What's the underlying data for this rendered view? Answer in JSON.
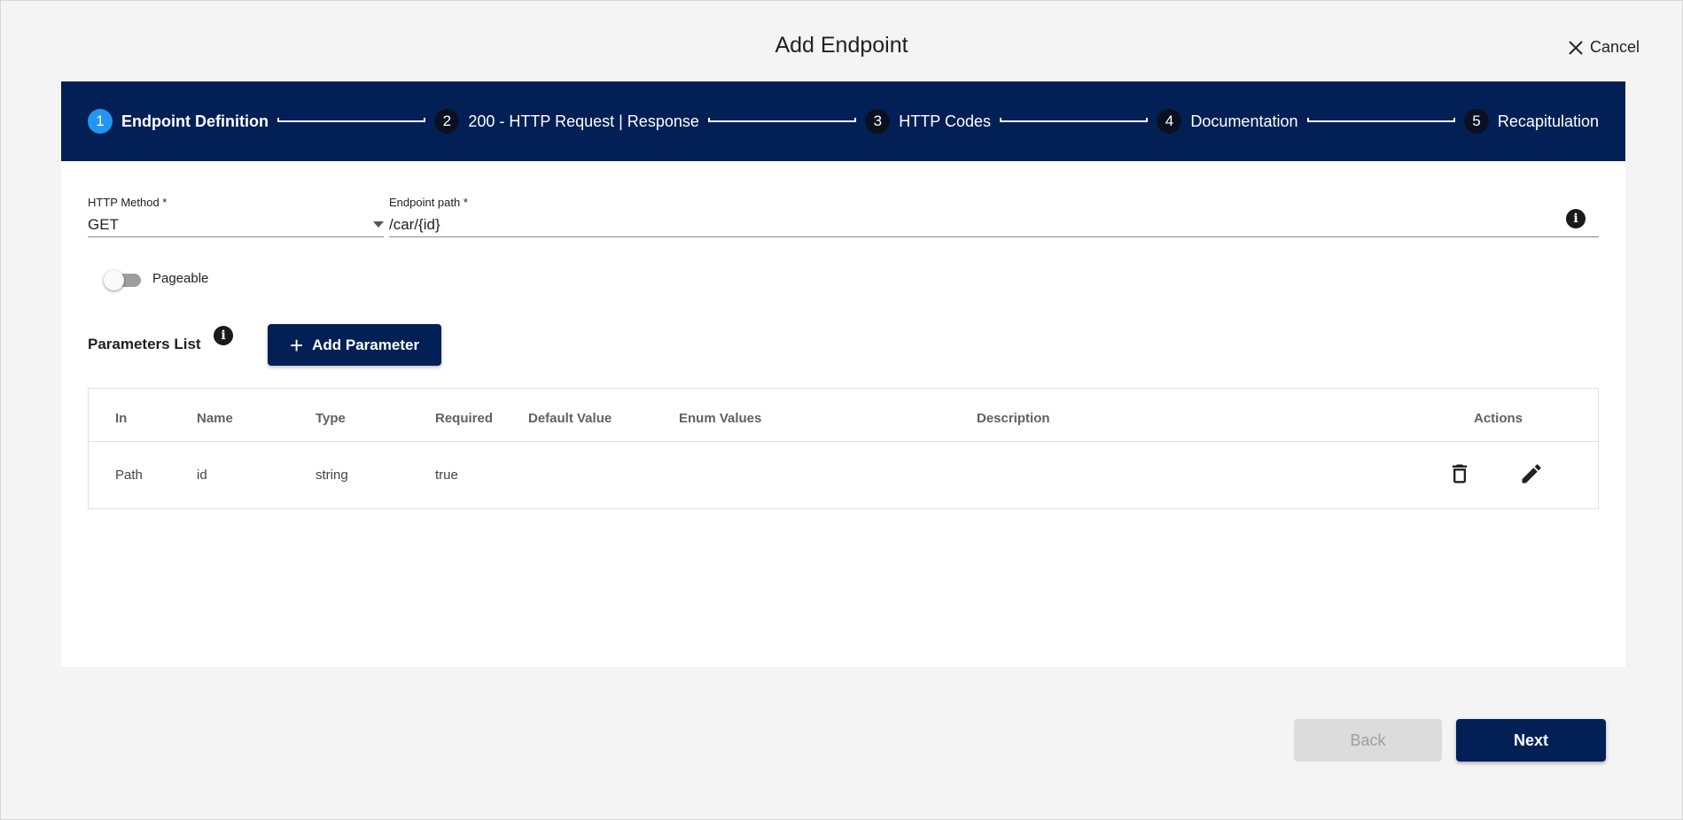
{
  "dialog": {
    "title": "Add Endpoint",
    "cancel_label": "Cancel"
  },
  "stepper": {
    "steps": [
      {
        "number": "1",
        "label": "Endpoint Definition"
      },
      {
        "number": "2",
        "label": "200 - HTTP Request | Response"
      },
      {
        "number": "3",
        "label": "HTTP Codes"
      },
      {
        "number": "4",
        "label": "Documentation"
      },
      {
        "number": "5",
        "label": "Recapitulation"
      }
    ],
    "active_step": 1
  },
  "form": {
    "method_label": "HTTP Method *",
    "method_value": "GET",
    "path_label": "Endpoint path *",
    "path_value": "/car/{id}",
    "pageable_label": "Pageable",
    "pageable_on": false
  },
  "parameters": {
    "title": "Parameters List",
    "add_label": "Add Parameter",
    "columns": [
      "In",
      "Name",
      "Type",
      "Required",
      "Default Value",
      "Enum Values",
      "Description",
      "Actions"
    ],
    "rows": [
      {
        "in": "Path",
        "name": "id",
        "type": "string",
        "required": "true",
        "default": "",
        "enum": "",
        "description": ""
      }
    ]
  },
  "footer": {
    "back_label": "Back",
    "next_label": "Next"
  },
  "colors": {
    "primary": "#022056",
    "active_step": "#2196f3"
  },
  "icons": {
    "cancel": "close-icon",
    "info": "info-icon",
    "add": "plus-icon",
    "delete": "trash-icon",
    "edit": "pencil-icon"
  }
}
